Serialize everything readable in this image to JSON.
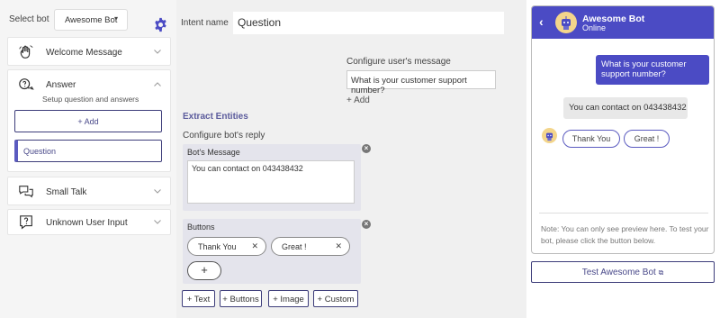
{
  "sidebar": {
    "select_label": "Select bot",
    "bot_select_value": "Awesome Bot",
    "items": [
      {
        "label": "Welcome Message"
      },
      {
        "label": "Answer",
        "subtitle": "Setup question and answers",
        "add_label": "+ Add",
        "questions": [
          "Question"
        ]
      },
      {
        "label": "Small Talk"
      },
      {
        "label": "Unknown User Input"
      }
    ]
  },
  "editor": {
    "intent_label": "Intent name",
    "intent_value": "Question",
    "configure_user_label": "Configure user's message",
    "user_message_value": "What is your customer support number?",
    "add_label": "+ Add",
    "extract_entities_label": "Extract Entities",
    "configure_bot_label": "Configure bot's reply",
    "bot_message_label": "Bot's Message",
    "bot_message_value": "You can contact on 043438432",
    "buttons_label": "Buttons",
    "buttons": [
      {
        "label": "Thank You"
      },
      {
        "label": "Great !"
      }
    ],
    "add_button_symbol": "+",
    "toolbar": [
      "+ Text",
      "+ Buttons",
      "+ Image",
      "+ Custom"
    ]
  },
  "preview": {
    "bot_name": "Awesome Bot",
    "status": "Online",
    "user_message": "What is your customer support number?",
    "bot_reply": "You can contact on 043438432",
    "quick_replies": [
      "Thank You",
      "Great !"
    ],
    "note": "Note: You can only see preview here. To test your bot, please click the button below.",
    "test_button_label": "Test Awesome Bot"
  },
  "colors": {
    "accent": "#4b4bc4",
    "border_dark": "#3d3d7a"
  }
}
